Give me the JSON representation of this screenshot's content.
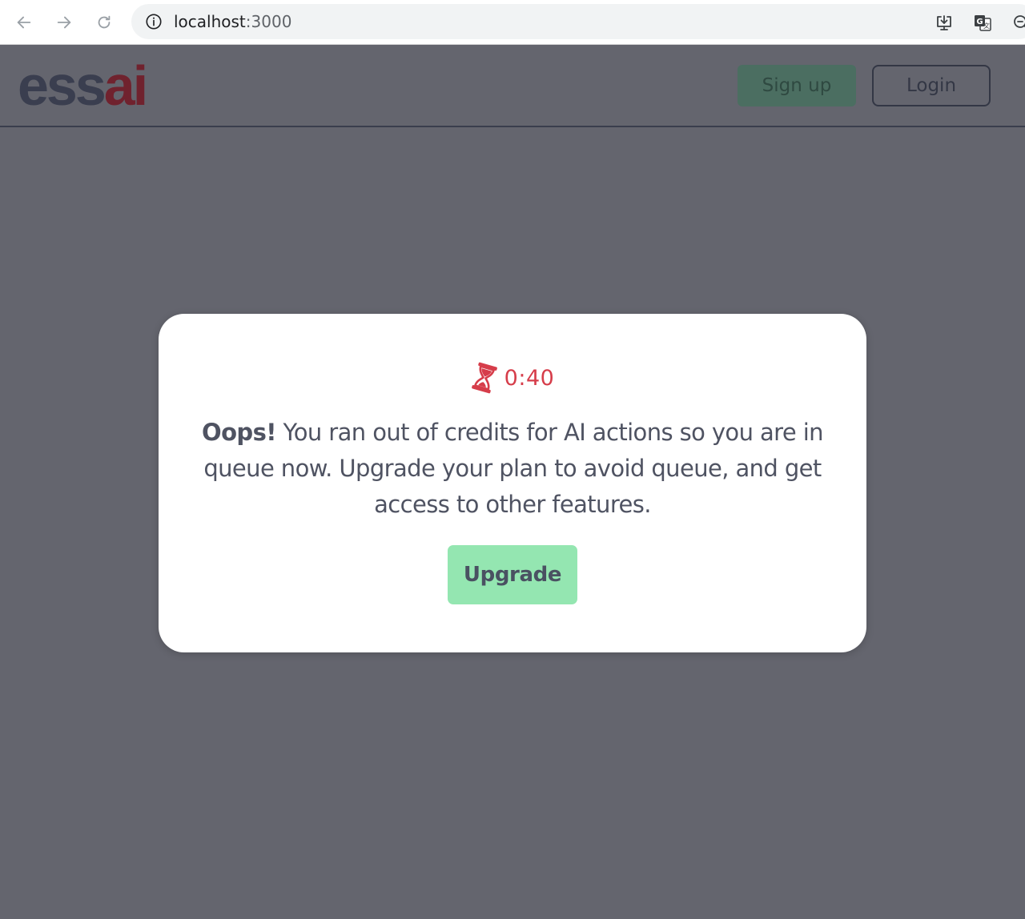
{
  "browser": {
    "url_host": "localhost",
    "url_port": ":3000",
    "icons": [
      "back-arrow-icon",
      "forward-arrow-icon",
      "reload-icon",
      "info-icon",
      "install-app-icon",
      "translate-icon",
      "zoom-icon"
    ]
  },
  "header": {
    "logo_main": "ess",
    "logo_accent": "ai",
    "signup_label": "Sign up",
    "login_label": "Login"
  },
  "modal": {
    "timer_icon": "hourglass-icon",
    "timer_value": "0:40",
    "message_lead": "Oops!",
    "message_body": " You ran out of credits for AI actions so you are in queue now. Upgrade your plan to avoid queue, and get access to other features.",
    "upgrade_label": "Upgrade"
  },
  "colors": {
    "overlay_background": "#64656e",
    "timer_red": "#d63d4a",
    "upgrade_green": "#94e6b1",
    "logo_dark": "#3a3e4f",
    "logo_accent": "#70222e"
  }
}
